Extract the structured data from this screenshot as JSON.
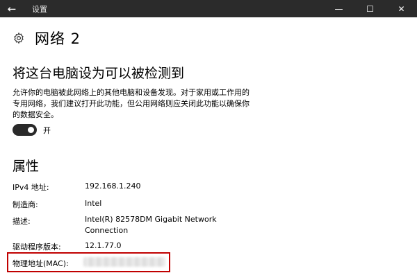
{
  "window": {
    "title": "设置",
    "back_glyph": "←",
    "minimize_glyph": "—",
    "maximize_glyph": "☐",
    "close_glyph": "✕"
  },
  "page": {
    "title": "网络  2",
    "icon": "gear-icon"
  },
  "discovery": {
    "heading": "将这台电脑设为可以被检测到",
    "description": "允许你的电脑被此网络上的其他电脑和设备发现。对于家用或工作用的专用网络，我们建议打开此功能，但公用网络则应关闭此功能以确保你的数据安全。",
    "toggle_state_label": "开",
    "toggle_on": true
  },
  "properties": {
    "heading": "属性",
    "rows": [
      {
        "label": "IPv4 地址:",
        "value": "192.168.1.240"
      },
      {
        "label": "制造商:",
        "value": "Intel"
      },
      {
        "label": "描述:",
        "value": "Intel(R) 82578DM Gigabit Network Connection"
      },
      {
        "label": "驱动程序版本:",
        "value": "12.1.77.0"
      },
      {
        "label": "物理地址(MAC):",
        "value": ""
      }
    ]
  },
  "colors": {
    "titlebar": "#2b2b2b",
    "highlight": "#c00000",
    "toggle_track": "#2a2a2a"
  }
}
